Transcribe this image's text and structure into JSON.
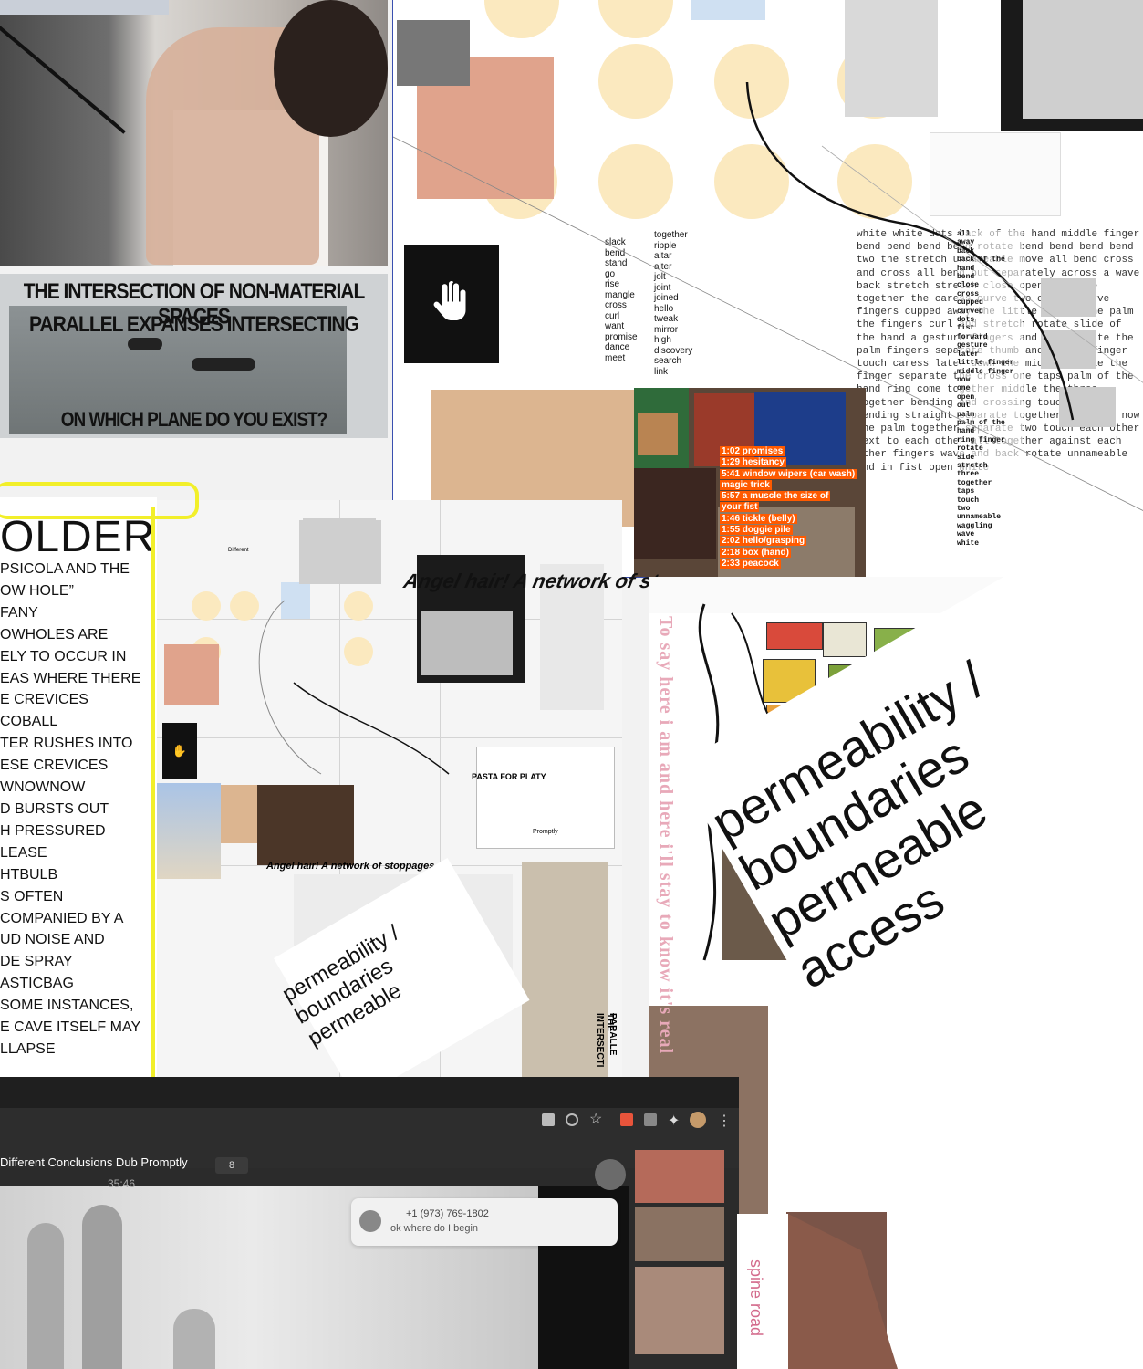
{
  "intersection": {
    "line1": "THE INTERSECTION OF NON-MATERIAL SPACES",
    "line2": "PARALLEL EXPANSES INTERSECTING",
    "line3": "ON WHICH PLANE DO YOU EXIST?"
  },
  "word_list_left": [
    "slack",
    "bend",
    "stand",
    "go",
    "rise",
    "mangle",
    "cross",
    "curl",
    "want",
    "promise",
    "dance",
    "meet"
  ],
  "word_list_right": [
    "together",
    "ripple",
    "altar",
    "alter",
    "jolt",
    "joint",
    "joined",
    "hello",
    "tweak",
    "mirror",
    "high",
    "discovery",
    "search",
    "link"
  ],
  "hand_text": "white white dots back of the hand middle finger bend bend bend bend rotate bend bend bend bend two the stretch unnameable move all bend cross and cross all bend but separately across a wave back stretch stretch close open separate together the caress curve two caress curve fingers cupped away the little finger the palm the fingers curl and stretch rotate slide of the hand a gesture fingers and back rotate the palm fingers separate thumb and little finger touch caress later down the middle middle the finger separate the cross one taps palm of the hand ring come together middle the three together bending and crossing touch tips bending straight separate together rotating now the palm together separate two touch each other next to each other all together against each other fingers wave and back rotate unnameable and in fist open white",
  "hand_col": [
    "all",
    "away",
    "back",
    "back of the hand",
    "bend",
    "close",
    "cross",
    "cupped",
    "curved",
    "dots",
    "fist",
    "forward",
    "gesture",
    "later",
    "little finger",
    "middle finger",
    "now",
    "one",
    "open",
    "out",
    "palm",
    "palm of the hand",
    "ring finger",
    "rotate",
    "side",
    "stretch",
    "three",
    "together",
    "taps",
    "touch",
    "two",
    "unnameable",
    "waggling",
    "wave",
    "white"
  ],
  "timeline": [
    "1:02 promises",
    "1:29 hesitancy",
    "5:41 window wipers (car wash)",
    "magic trick",
    "5:57 a muscle the size of",
    "your fist",
    "1:46 tickle (belly)",
    "1:55 doggie pile",
    "2:02 hello/grasping",
    "2:18 box (hand)",
    "2:33 peacock"
  ],
  "angel_title": "Angel hair! A network of stoppages",
  "angel_title_small": "Angel hair! A network of stoppages",
  "thunder_heading": "OLDER",
  "left_text": [
    "PSICOLA AND THE",
    "OW HOLE”",
    "FANY",
    "OWHOLES ARE",
    "ELY TO OCCUR IN",
    "EAS WHERE THERE",
    "E CREVICES",
    "COBALL",
    "TER RUSHES INTO",
    "ESE CREVICES",
    "WNOWNOW",
    "D BURSTS OUT",
    "H PRESSURED",
    "LEASE",
    "HTBULB",
    "S OFTEN",
    "COMPANIED BY A",
    "UD NOISE AND",
    "DE SPRAY",
    "ASTICBAG",
    "SOME INSTANCES,",
    "E CAVE ITSELF MAY",
    "LLAPSE"
  ],
  "vertical_quote": "To say here i am and here i'll stay to know it's real",
  "perm_lines": [
    "permeability /",
    "boundaries",
    "permeable",
    "access"
  ],
  "perm_small_lines": [
    "permeability /",
    "boundaries",
    "permeable"
  ],
  "video": {
    "title": "Different Conclusions Dub Promptly",
    "time": "35:46",
    "count": "8"
  },
  "chat": {
    "phone": "+1 (973) 769-1802",
    "message": "ok where do I begin"
  },
  "spine_road": "spine road",
  "mid_small": {
    "pasta": "PASTA FOR PLATY",
    "intersection_vertical": "THE INTERSECTI",
    "parallel_vertical": "PARALLE",
    "prompty": "Promptly",
    "different": "Different"
  },
  "colors": {
    "yellow": "#f2ef2a",
    "dot": "#fbe9bf",
    "timeline": "#ff5a00",
    "pink": "#e8a9b9",
    "blue_border": "#3a50b0"
  }
}
